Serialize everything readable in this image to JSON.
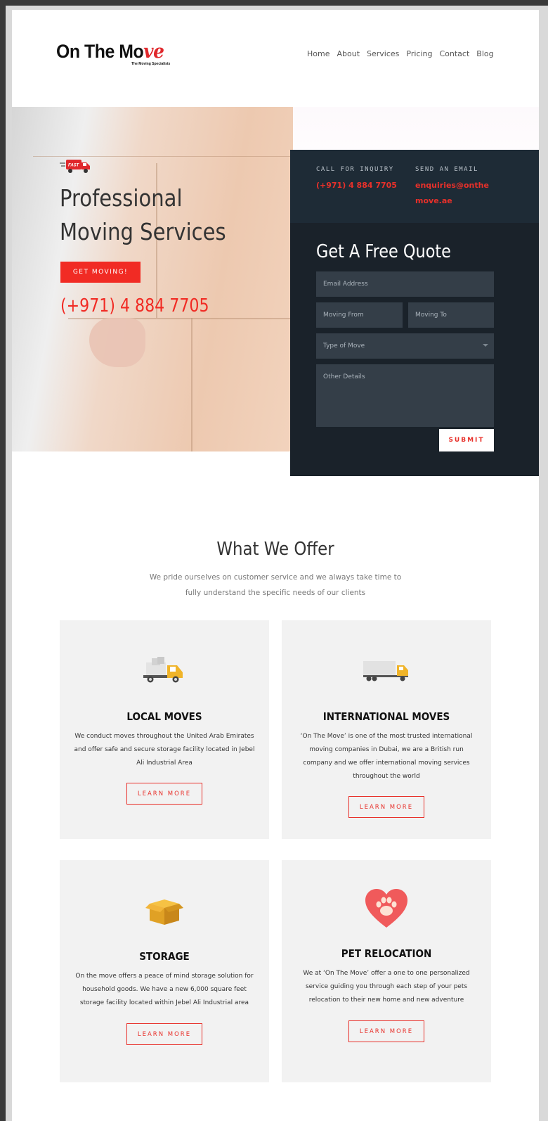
{
  "brand": {
    "logo_text_a": "On The Mo",
    "logo_text_accent": "ve",
    "tagline": "The Moving Specialists"
  },
  "nav": {
    "items": [
      "Home",
      "About",
      "Services",
      "Pricing",
      "Contact",
      "Blog"
    ]
  },
  "hero": {
    "badge_text": "FAST",
    "title": "Professional Moving Services",
    "cta_label": "GET MOVING!",
    "phone": "(+971) 4 884 7705"
  },
  "contact": {
    "call_label": "CALL FOR INQUIRY",
    "call_value": "(+971) 4 884 7705",
    "email_label": "SEND AN EMAIL",
    "email_value": "enquiries@onthemove.ae"
  },
  "quote_form": {
    "title": "Get A Free Quote",
    "email_placeholder": "Email Address",
    "from_placeholder": "Moving From",
    "to_placeholder": "Moving To",
    "type_selected": "Type of Move",
    "details_placeholder": "Other Details",
    "submit_label": "SUBMIT"
  },
  "offer": {
    "title": "What We Offer",
    "subtitle": "We pride ourselves on customer service and we always take time to fully understand the specific needs of our clients",
    "cards": [
      {
        "title": "LOCAL MOVES",
        "text": "We conduct moves throughout the United Arab Emirates and offer safe and secure storage facility located in Jebel Ali Industrial Area",
        "button": "LEARN MORE",
        "icon": "local-truck-icon"
      },
      {
        "title": "INTERNATIONAL MOVES",
        "text": "‘On The Move’ is one of the most trusted international moving companies in Dubai, we are a British run company and we offer international moving services throughout the world",
        "button": "LEARN MORE",
        "icon": "container-truck-icon"
      },
      {
        "title": "STORAGE",
        "text": "On the move offers a peace of mind storage solution for household goods. We have a new 6,000 square feet storage facility located within Jebel Ali Industrial area",
        "button": "LEARN MORE",
        "icon": "box-icon"
      },
      {
        "title": "PET RELOCATION",
        "text": "We at ‘On The Move’ offer a one to one personalized service guiding you through each step of your pets relocation to their new home and new adventure",
        "button": "LEARN MORE",
        "icon": "paw-heart-icon"
      }
    ]
  },
  "colors": {
    "accent": "#f12b24",
    "panel_dark": "#1a222a",
    "panel_top": "#1e2b36",
    "card_bg": "#f2f2f2"
  }
}
